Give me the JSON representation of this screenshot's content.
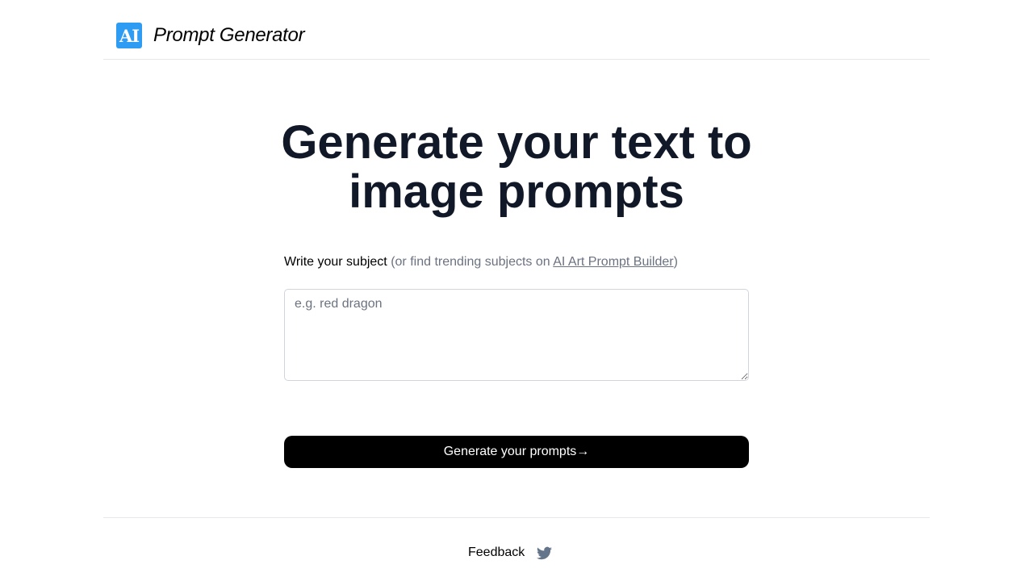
{
  "header": {
    "logo_text": "AI",
    "logo_color": "#2e9cf2",
    "title": "Prompt Generator"
  },
  "hero": {
    "title_line1": "Generate your text to",
    "title_line2": "image prompts"
  },
  "form": {
    "label": "Write your subject",
    "hint_prefix": "(or find trending subjects on ",
    "hint_link": "AI Art Prompt Builder",
    "hint_suffix": ")",
    "input_placeholder": "e.g. red dragon",
    "input_value": "",
    "submit_label": "Generate your prompts→"
  },
  "footer": {
    "feedback_label": "Feedback",
    "twitter_icon": "twitter-icon"
  },
  "colors": {
    "text_dark": "#111827",
    "text_muted": "#6b7280",
    "button_bg": "#000000",
    "twitter_icon": "#64748b"
  }
}
